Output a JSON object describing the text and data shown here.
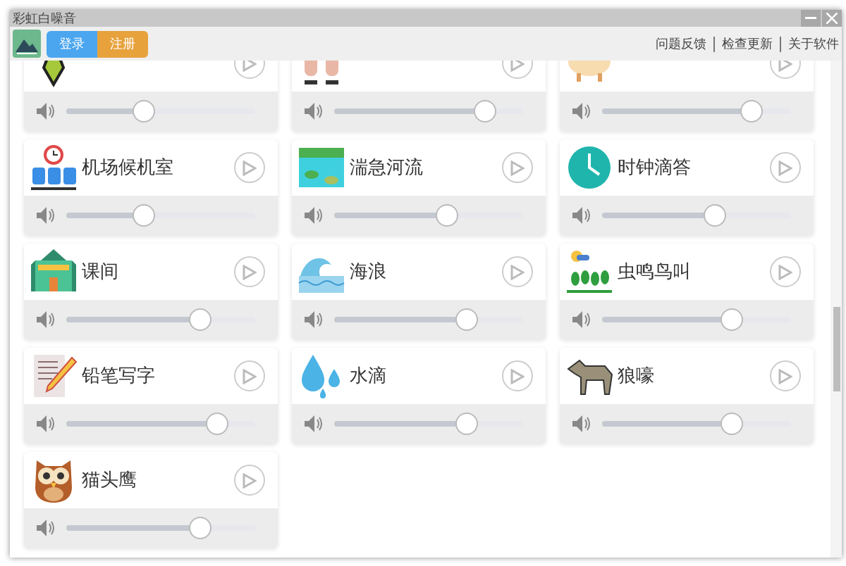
{
  "window": {
    "title": "彩虹白噪音"
  },
  "toolbar": {
    "buttons": [
      {
        "label": "登录",
        "kind": "primary"
      },
      {
        "label": "注册",
        "kind": "accent"
      }
    ],
    "links": [
      "问题反馈",
      "检查更新",
      "关于软件"
    ]
  },
  "sounds": [
    {
      "level": 0.41
    },
    {
      "level": 0.8
    },
    {
      "level": 0.79
    },
    {
      "name": "机场候机室",
      "level": 0.41
    },
    {
      "name": "湍急河流",
      "level": 0.6
    },
    {
      "name": "时钟滴答",
      "level": 0.6
    },
    {
      "name": "课间",
      "level": 0.71
    },
    {
      "name": "海浪",
      "level": 0.7
    },
    {
      "name": "虫鸣鸟叫",
      "level": 0.69
    },
    {
      "name": "铅笔写字",
      "level": 0.8
    },
    {
      "name": "水滴",
      "level": 0.7
    },
    {
      "name": "狼嚎",
      "level": 0.69
    },
    {
      "name": "猫头鹰",
      "level": 0.71
    }
  ]
}
